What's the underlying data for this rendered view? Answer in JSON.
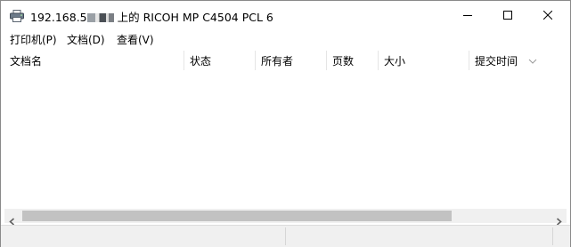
{
  "window": {
    "title_prefix": "192.168.5",
    "title_suffix": "上的 RICOH MP C4504 PCL 6"
  },
  "menu": [
    {
      "label": "打印机(P)"
    },
    {
      "label": "文档(D)"
    },
    {
      "label": "查看(V)"
    }
  ],
  "columns": [
    {
      "label": "文档名"
    },
    {
      "label": "状态"
    },
    {
      "label": "所有者"
    },
    {
      "label": "页数"
    },
    {
      "label": "大小"
    },
    {
      "label": "提交时间"
    }
  ],
  "icons": {
    "app": "printer-icon",
    "minimize": "minimize-icon",
    "maximize": "maximize-icon",
    "close": "close-icon",
    "sort": "chevron-down-icon",
    "scroll_left": "chevron-left-icon",
    "scroll_right": "chevron-right-icon"
  }
}
